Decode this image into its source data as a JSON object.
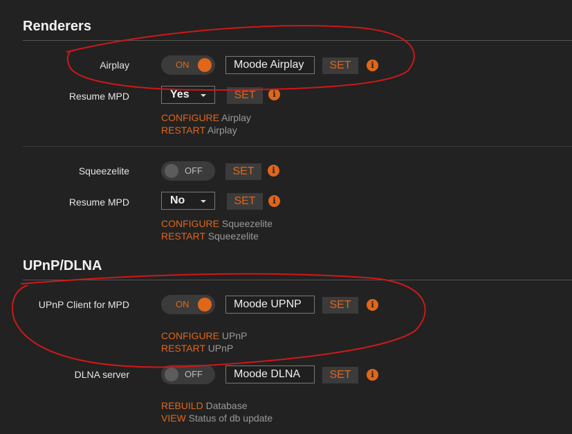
{
  "renderers": {
    "title": "Renderers",
    "airplay": {
      "label": "Airplay",
      "toggle": "ON",
      "name_value": "Moode Airplay",
      "set": "SET",
      "resume_label": "Resume MPD",
      "resume_value": "Yes",
      "resume_set": "SET",
      "configure": "CONFIGURE",
      "configure_target": "Airplay",
      "restart": "RESTART",
      "restart_target": "Airplay"
    },
    "squeezelite": {
      "label": "Squeezelite",
      "toggle": "OFF",
      "set": "SET",
      "resume_label": "Resume MPD",
      "resume_value": "No",
      "resume_set": "SET",
      "configure": "CONFIGURE",
      "configure_target": "Squeezelite",
      "restart": "RESTART",
      "restart_target": "Squeezelite"
    }
  },
  "upnp": {
    "title": "UPnP/DLNA",
    "client": {
      "label": "UPnP Client for MPD",
      "toggle": "ON",
      "name_value": "Moode UPNP",
      "set": "SET",
      "configure": "CONFIGURE",
      "configure_target": "UPnP",
      "restart": "RESTART",
      "restart_target": "UPnP"
    },
    "dlna": {
      "label": "DLNA server",
      "toggle": "OFF",
      "name_value": "Moode DLNA",
      "set": "SET",
      "rebuild": "REBUILD",
      "rebuild_target": "Database",
      "view": "VIEW",
      "view_target": "Status of db update"
    }
  },
  "icons": {
    "info": "i"
  },
  "colors": {
    "accent": "#e0661a",
    "background": "#222222",
    "annotation": "#d01818"
  }
}
